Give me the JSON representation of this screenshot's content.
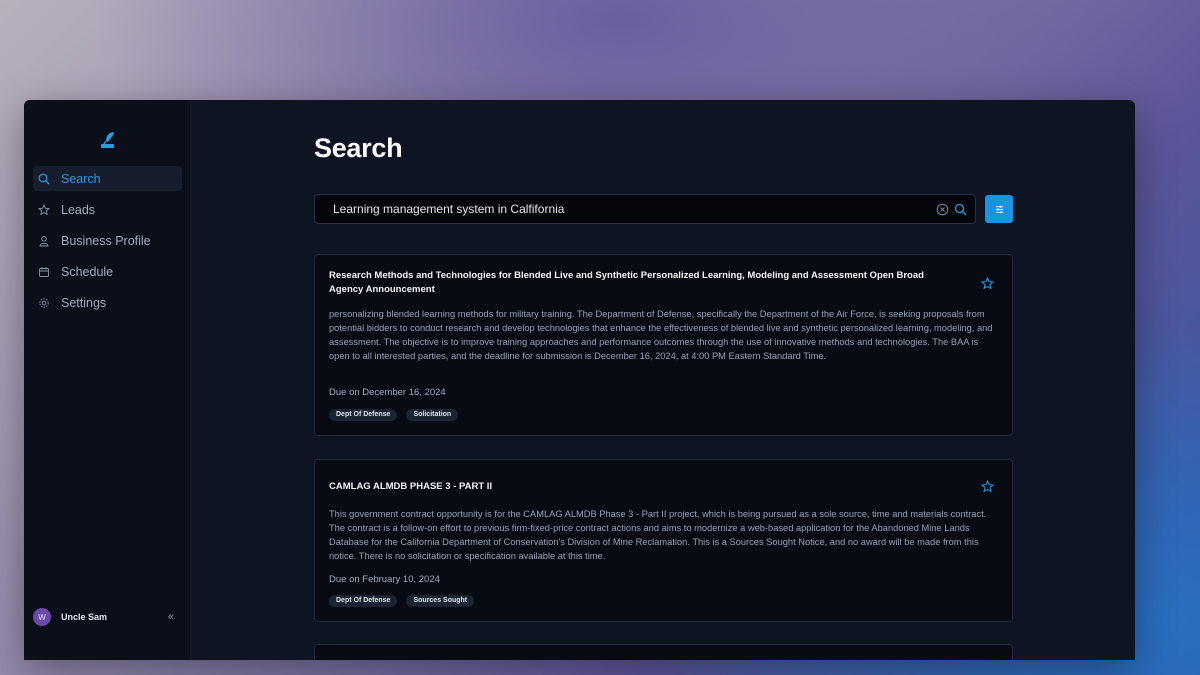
{
  "sidebar": {
    "items": [
      {
        "label": "Search",
        "icon": "search-icon",
        "active": true
      },
      {
        "label": "Leads",
        "icon": "star-icon"
      },
      {
        "label": "Business Profile",
        "icon": "user-icon"
      },
      {
        "label": "Schedule",
        "icon": "calendar-icon"
      },
      {
        "label": "Settings",
        "icon": "gear-icon"
      }
    ],
    "user": {
      "initial": "W",
      "name": "Uncle Sam"
    },
    "collapse_glyph": "«"
  },
  "main": {
    "title": "Search",
    "search": {
      "value": "Learning management system in Calfifornia"
    },
    "results": [
      {
        "title": "Research Methods and Technologies for Blended Live and Synthetic Personalized Learning, Modeling and Assessment Open Broad Agency Announcement",
        "description": "personalizing blended learning methods for military training. The Department of Defense, specifically the Department of the Air Force, is seeking proposals from potential bidders to conduct research and develop technologies that enhance the effectiveness of blended live and synthetic personalized learning, modeling, and assessment. The objective is to improve training approaches and performance outcomes through the use of innovative methods and technologies. The BAA is open to all interested parties, and the deadline for submission is December 16, 2024, at 4:00 PM Eastern Standard Time.",
        "due": "Due on December 16, 2024",
        "tags": [
          "Dept Of Defense",
          "Solicitation"
        ]
      },
      {
        "title": "CAMLAG ALMDB PHASE 3 - PART II",
        "description": "This government contract opportunity is for the CAMLAG ALMDB Phase 3 - Part II project, which is being pursued as a sole source, time and materials contract. The contract is a follow-on effort to previous firm-fixed-price contract actions and aims to modernize a web-based application for the Abandoned Mine Lands Database for the California Department of Conservation's Division of Mine Reclamation. This is a Sources Sought Notice, and no award will be made from this notice. There is no solicitation or specification available at this time.",
        "due": "Due on February 10, 2024",
        "tags": [
          "Dept Of Defense",
          "Sources Sought"
        ]
      }
    ]
  },
  "colors": {
    "accent": "#2f9ae0",
    "button": "#1a94de",
    "avatar": "#6a4aa6"
  }
}
